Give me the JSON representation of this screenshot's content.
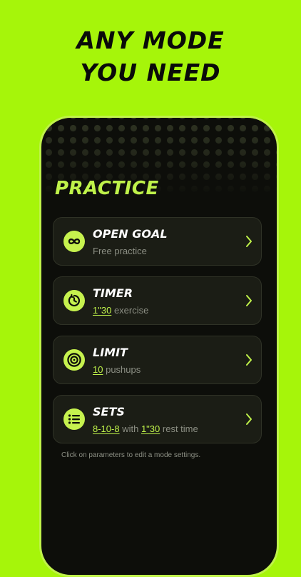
{
  "headline": {
    "line1": "ANY MODE",
    "line2": "YOU NEED"
  },
  "section_title": "PRACTICE",
  "modes": [
    {
      "title": "OPEN GOAL",
      "subtitle": "Free practice",
      "icon": "infinity-icon"
    },
    {
      "title": "TIMER",
      "value": "1\"30",
      "unit": "exercise",
      "icon": "timer-icon"
    },
    {
      "title": "LIMIT",
      "value": "10",
      "unit": "pushups",
      "icon": "target-icon"
    },
    {
      "title": "SETS",
      "value": "8-10-8",
      "joiner": "with",
      "value2": "1\"30",
      "unit": "rest time",
      "icon": "list-icon"
    }
  ],
  "hint": "Click on parameters to edit a mode settings.",
  "colors": {
    "background": "#a6f50a",
    "accent": "#bff24a",
    "card": "#1b1d15",
    "phone": "#0d0e0a"
  }
}
